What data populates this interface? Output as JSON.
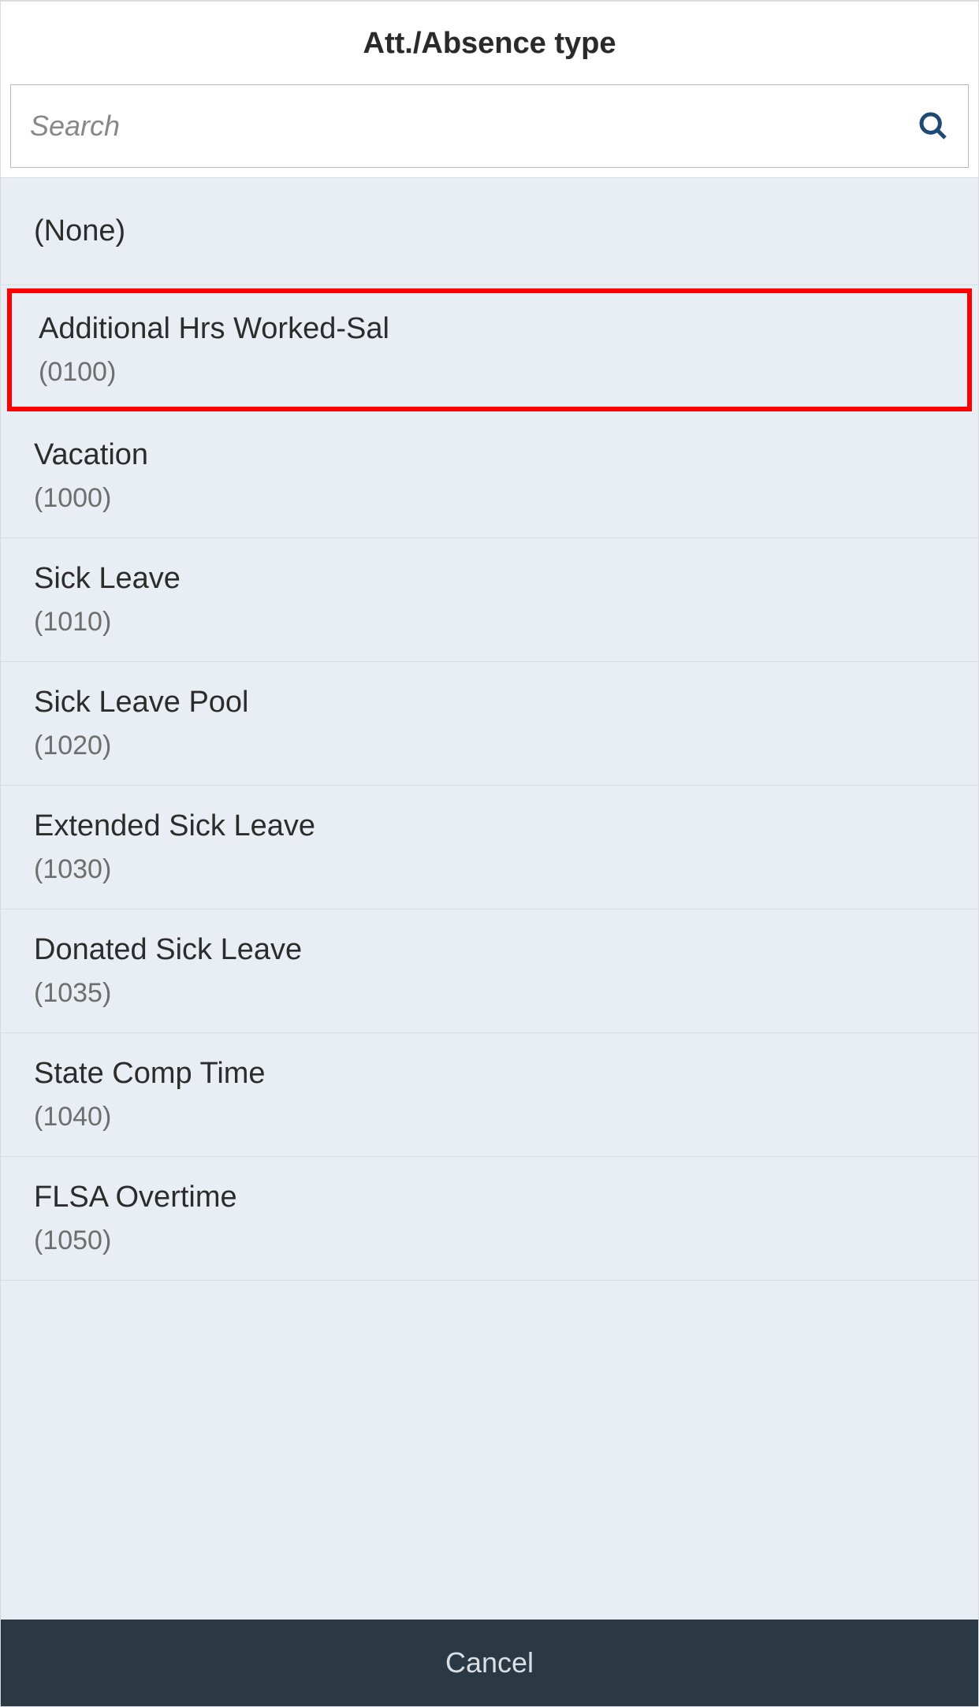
{
  "header": {
    "title": "Att./Absence type"
  },
  "search": {
    "placeholder": "Search"
  },
  "items": [
    {
      "title": "(None)",
      "code": null,
      "none": true
    },
    {
      "title": "Additional Hrs Worked-Sal",
      "code": "(0100)",
      "highlighted": true
    },
    {
      "title": "Vacation",
      "code": "(1000)"
    },
    {
      "title": "Sick Leave",
      "code": "(1010)"
    },
    {
      "title": "Sick Leave Pool",
      "code": "(1020)"
    },
    {
      "title": "Extended Sick Leave",
      "code": "(1030)"
    },
    {
      "title": "Donated Sick Leave",
      "code": "(1035)"
    },
    {
      "title": "State Comp Time",
      "code": "(1040)"
    },
    {
      "title": "FLSA Overtime",
      "code": "(1050)"
    }
  ],
  "footer": {
    "cancel_label": "Cancel"
  }
}
